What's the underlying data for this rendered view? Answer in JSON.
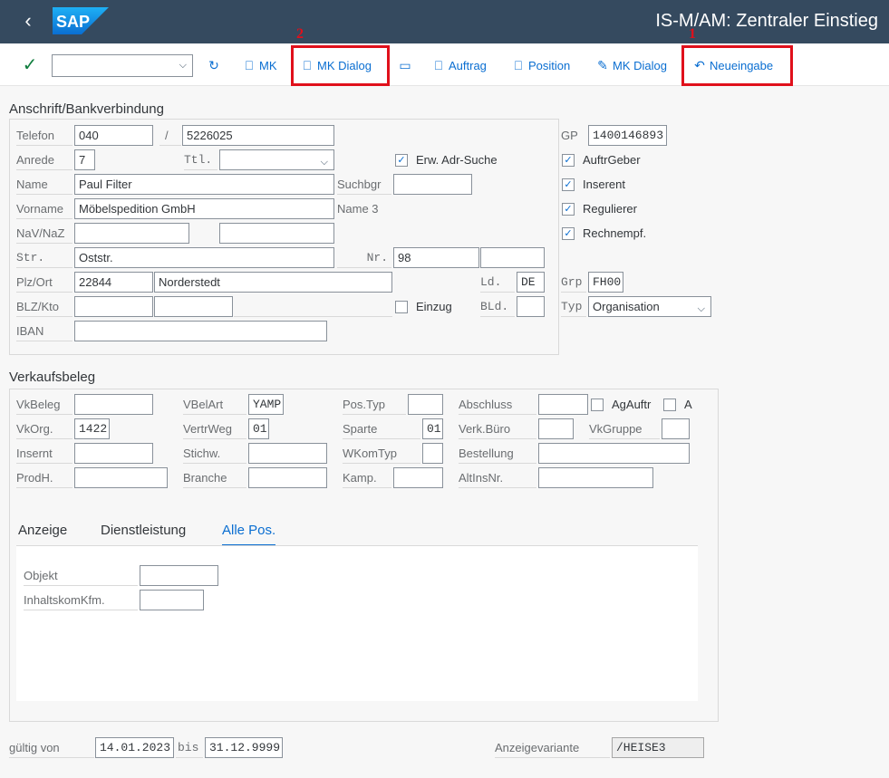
{
  "header": {
    "title": "IS-M/AM: Zentraler Einstieg",
    "logo": "SAP"
  },
  "toolbar": {
    "mk": "MK",
    "mk_dialog": "MK Dialog",
    "auftrag": "Auftrag",
    "position": "Position",
    "mk_dialog_edit": "MK Dialog",
    "neueingabe": "Neueingabe",
    "callout_1": "1",
    "callout_2": "2"
  },
  "anschrift": {
    "title": "Anschrift/Bankverbindung",
    "telefon_label": "Telefon",
    "telefon_prefix": "040",
    "slash": "/",
    "telefon_number": "5226025",
    "anrede_label": "Anrede",
    "anrede": "7",
    "ttl_label": "Ttl.",
    "erw_adr_suche": "Erw. Adr-Suche",
    "name_label": "Name",
    "name": "Paul Filter",
    "suchbgr_label": "Suchbgr",
    "vorname_label": "Vorname",
    "vorname": "Möbelspedition GmbH",
    "name3_label": "Name 3",
    "nav_naz_label": "NaV/NaZ",
    "str_label": "Str.",
    "str": "Oststr.",
    "nr_label": "Nr.",
    "nr": "98",
    "plz_ort_label": "Plz/Ort",
    "plz": "22844",
    "ort": "Norderstedt",
    "ld_label": "Ld.",
    "ld": "DE",
    "blz_kto_label": "BLZ/Kto",
    "einzug": "Einzug",
    "bld_label": "BLd.",
    "iban_label": "IBAN",
    "gp_label": "GP",
    "gp": "1400146893",
    "auftrgeber": "AuftrGeber",
    "inserent": "Inserent",
    "regulierer": "Regulierer",
    "rechnempf": "Rechnempf.",
    "grp_label": "Grp",
    "grp": "FH00",
    "typ_label": "Typ",
    "typ": "Organisation"
  },
  "verkauf": {
    "title": "Verkaufsbeleg",
    "vkbeleg_label": "VkBeleg",
    "vbelart_label": "VBelArt",
    "vbelart": "YAMP",
    "postyp_label": "Pos.Typ",
    "abschluss_label": "Abschluss",
    "agauftr": "AgAuftr",
    "a": "A",
    "vkorg_label": "VkOrg.",
    "vkorg": "1422",
    "vertrweg_label": "VertrWeg",
    "vertrweg": "01",
    "sparte_label": "Sparte",
    "sparte": "01",
    "verkbuero_label": "Verk.Büro",
    "vkgruppe_label": "VkGruppe",
    "insernt_label": "Insernt",
    "stichw_label": "Stichw.",
    "wkomtyp_label": "WKomTyp",
    "bestellung_label": "Bestellung",
    "prodh_label": "ProdH.",
    "branche_label": "Branche",
    "kamp_label": "Kamp.",
    "altinsnr_label": "AltInsNr."
  },
  "tabs": [
    {
      "label": "Anzeige"
    },
    {
      "label": "Dienstleistung"
    },
    {
      "label": "Alle Pos."
    }
  ],
  "tabpanel": {
    "objekt_label": "Objekt",
    "inhaltskom_label": "InhaltskomKfm."
  },
  "footer": {
    "gueltig_label": "gültig  von",
    "von": "14.01.2023",
    "bis_label": "bis",
    "bis": "31.12.9999",
    "anzeigevariante_label": "Anzeigevariante",
    "anzeigevariante": "/HEISE3"
  }
}
